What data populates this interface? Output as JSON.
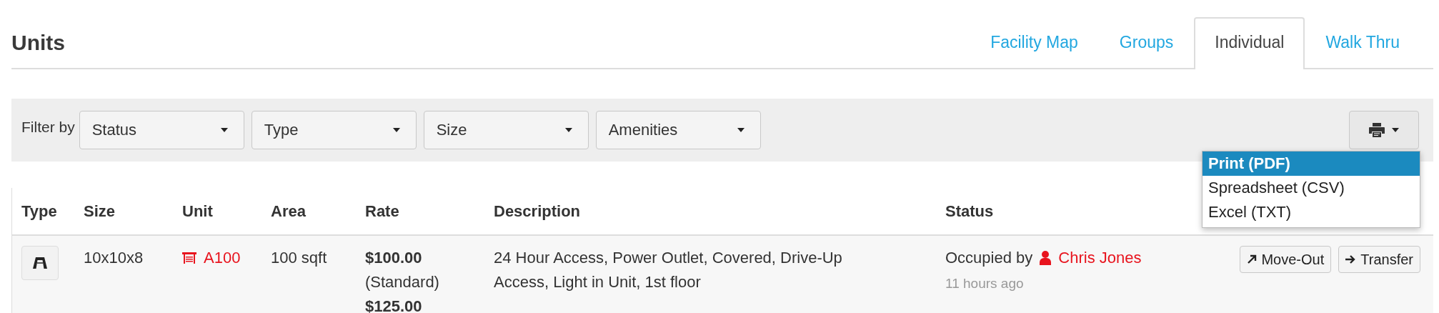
{
  "page": {
    "title": "Units"
  },
  "tabs": [
    {
      "label": "Facility Map",
      "selected": false
    },
    {
      "label": "Groups",
      "selected": false
    },
    {
      "label": "Individual",
      "selected": true
    },
    {
      "label": "Walk Thru",
      "selected": false
    }
  ],
  "filter_bar": {
    "label": "Filter by",
    "filters": [
      {
        "label": "Status"
      },
      {
        "label": "Type"
      },
      {
        "label": "Size"
      },
      {
        "label": "Amenities"
      }
    ],
    "print_menu": {
      "open": true,
      "items": [
        {
          "label": "Print (PDF)",
          "selected": true
        },
        {
          "label": "Spreadsheet (CSV)",
          "selected": false
        },
        {
          "label": "Excel (TXT)",
          "selected": false
        }
      ]
    }
  },
  "table": {
    "columns": [
      "Type",
      "Size",
      "Unit",
      "Area",
      "Rate",
      "Description",
      "Status"
    ],
    "rows": [
      {
        "size": "10x10x8",
        "unit": "A100",
        "area": "100 sqft",
        "rate": [
          {
            "kind": "amount",
            "text": "$100.00"
          },
          {
            "kind": "note",
            "text": "(Standard)"
          },
          {
            "kind": "amount",
            "text": "$125.00"
          }
        ],
        "description": "24 Hour Access, Power Outlet, Covered, Drive-Up Access, Light in Unit, 1st floor",
        "status": {
          "label": "Occupied by",
          "tenant": "Chris Jones",
          "time": "11 hours ago"
        },
        "actions": [
          {
            "kind": "move-out",
            "label": "Move-Out"
          },
          {
            "kind": "transfer",
            "label": "Transfer"
          }
        ]
      }
    ]
  }
}
